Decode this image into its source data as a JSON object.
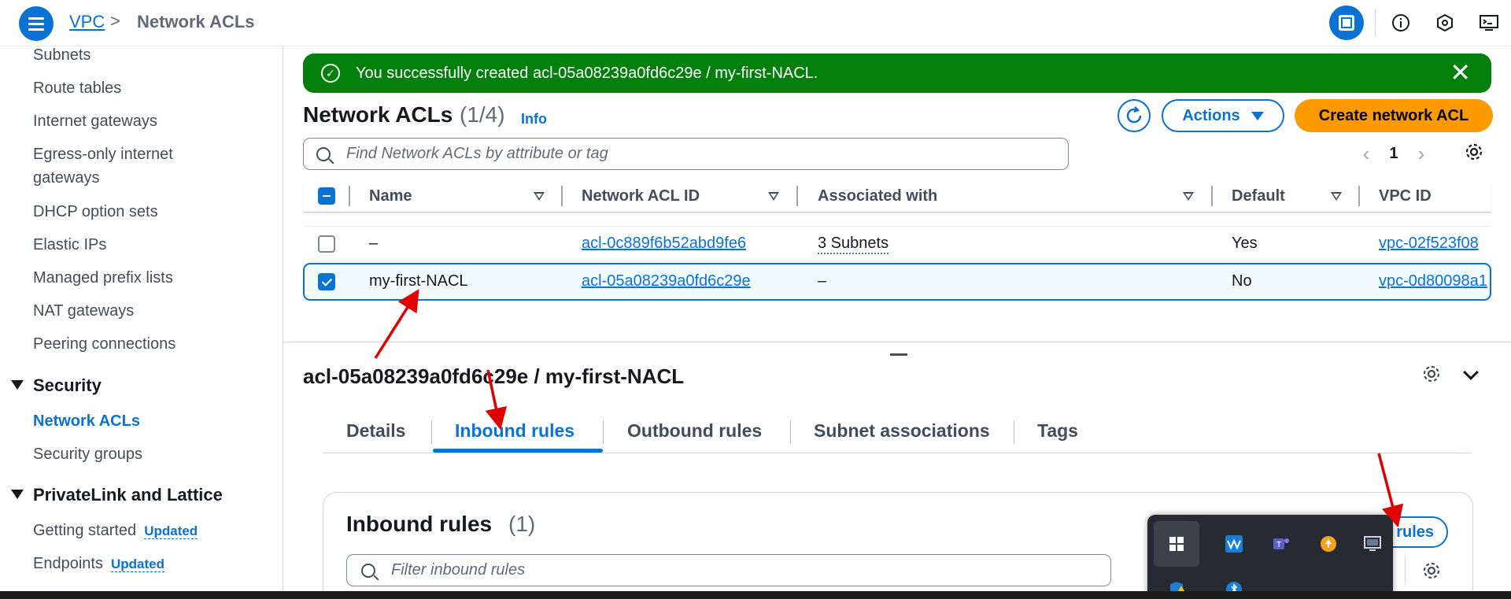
{
  "header": {
    "breadcrumb": {
      "service": "VPC",
      "separator": ">",
      "current": "Network ACLs"
    },
    "icons": [
      "menu-icon",
      "panel-icon",
      "info-icon",
      "settings-hex-icon",
      "cloudshell-icon"
    ]
  },
  "sidebar": {
    "items": [
      {
        "label": "Subnets"
      },
      {
        "label": "Route tables"
      },
      {
        "label": "Internet gateways"
      },
      {
        "label": "Egress-only internet"
      },
      {
        "label": "gateways"
      },
      {
        "label": "DHCP option sets"
      },
      {
        "label": "Elastic IPs"
      },
      {
        "label": "Managed prefix lists"
      },
      {
        "label": "NAT gateways"
      },
      {
        "label": "Peering connections"
      }
    ],
    "security": {
      "heading": "Security",
      "items": [
        {
          "label": "Network ACLs"
        },
        {
          "label": "Security groups"
        }
      ]
    },
    "privatelink": {
      "heading": "PrivateLink and Lattice",
      "items": [
        {
          "label": "Getting started",
          "badge": "Updated"
        },
        {
          "label": "Endpoints",
          "badge": "Updated"
        }
      ]
    }
  },
  "flash": {
    "message": "You successfully created acl-05a08239a0fd6c29e / my-first-NACL.",
    "dismiss": "✕"
  },
  "list": {
    "title": "Network ACLs",
    "count": "(1/4)",
    "info": "Info",
    "actions_label": "Actions",
    "create_label": "Create network ACL",
    "search_placeholder": "Find Network ACLs by attribute or tag",
    "page": "1",
    "columns": [
      "Name",
      "Network ACL ID",
      "Associated with",
      "Default",
      "VPC ID"
    ],
    "rows": [
      {
        "name": "–",
        "acl_id": "acl-0c889f6b52abd9fe6",
        "associated": "3 Subnets",
        "default": "Yes",
        "vpc_id": "vpc-02f523f08",
        "selected": false
      },
      {
        "name": "my-first-NACL",
        "acl_id": "acl-05a08239a0fd6c29e",
        "associated": "–",
        "default": "No",
        "vpc_id": "vpc-0d80098a1",
        "selected": true
      }
    ]
  },
  "details": {
    "title": "acl-05a08239a0fd6c29e / my-first-NACL",
    "tabs": [
      "Details",
      "Inbound rules",
      "Outbound rules",
      "Subnet associations",
      "Tags"
    ],
    "active_tab": "Inbound rules",
    "inbound": {
      "title": "Inbound rules",
      "count": "(1)",
      "search_placeholder": "Filter inbound rules",
      "edit_label": "rules"
    }
  },
  "colors": {
    "primary": "#0972d3",
    "success": "#037f0c",
    "cta": "#ff9900",
    "annotation": "#e00000"
  }
}
